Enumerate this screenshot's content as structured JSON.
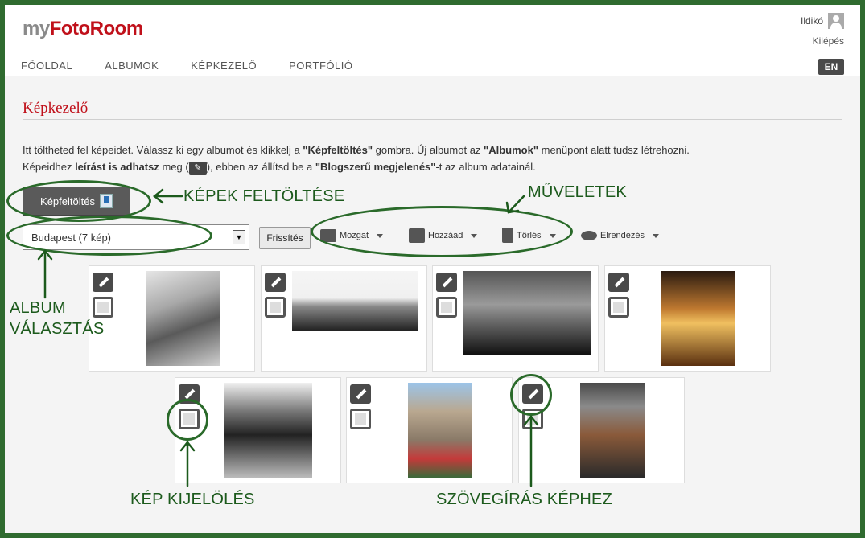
{
  "app": {
    "logo_my": "my",
    "logo_brand": "FotoRoom"
  },
  "user": {
    "name": "Ildikó",
    "logout": "Kilépés"
  },
  "nav": [
    {
      "label": "FŐOLDAL"
    },
    {
      "label": "ALBUMOK"
    },
    {
      "label": "KÉPKEZELŐ"
    },
    {
      "label": "PORTFÓLIÓ"
    }
  ],
  "lang_button": "EN",
  "page": {
    "title": "Képkezelő",
    "intro_1a": "Itt töltheted fel képeidet. Válassz ki egy albumot és klikkelj a ",
    "intro_1b": "\"Képfeltöltés\"",
    "intro_1c": " gombra. Új albumot az ",
    "intro_1d": "\"Albumok\"",
    "intro_1e": " menüpont alatt tudsz létrehozni.",
    "intro_2a": "Képeidhez ",
    "intro_2b": "leírást is adhatsz",
    "intro_2c": " meg (",
    "intro_2d": "), ebben az állítsd be a ",
    "intro_2e": "\"Blogszerű megjelenés\"",
    "intro_2f": "-t az album adatainál."
  },
  "toolbar": {
    "upload_label": "Képfeltöltés",
    "album_selected": "Budapest (7 kép)",
    "refresh_label": "Frissítés",
    "move_label": "Mozgat",
    "add_label": "Hozzáad",
    "delete_label": "Törlés",
    "arrange_label": "Elrendezés"
  },
  "annotations": {
    "upload": "KÉPEK FELTÖLTÉSE",
    "actions": "MŰVELETEK",
    "album_choice_1": "ALBUM",
    "album_choice_2": "VÁLASZTÁS",
    "select_image": "KÉP KIJELÖLÉS",
    "caption": "SZÖVEGÍRÁS KÉPHEZ"
  },
  "thumbnails_count": 7,
  "colors": {
    "brand": "#c0101a",
    "annotation": "#1c5a1c",
    "frame": "#2f6b2f"
  }
}
